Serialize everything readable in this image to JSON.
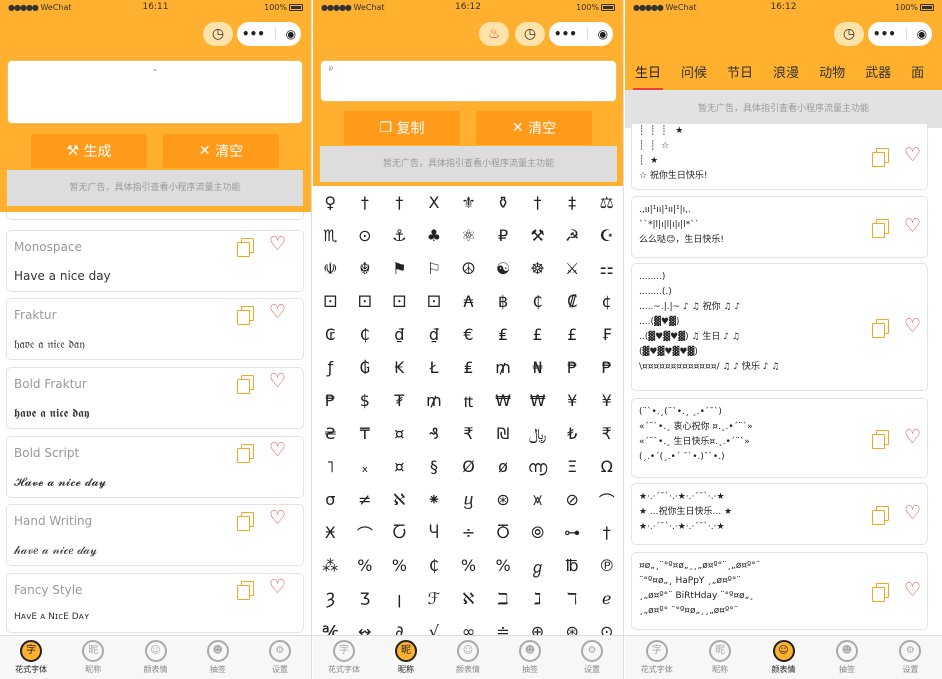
{
  "status": {
    "carrier": "WeChat",
    "battery": "100%",
    "time1": "16:11",
    "time2": "16:12",
    "time3": "16:12"
  },
  "capsule": {
    "menu": "•••",
    "close": "◉"
  },
  "panel1": {
    "input_value": "-",
    "generate_label": "生成",
    "clear_label": "清空",
    "ad_text": "暂无广告，具体指引查看小程序流量主功能",
    "styles": [
      {
        "name": "Monospace",
        "sample": "Have a nice day"
      },
      {
        "name": "Fraktur",
        "sample": "𝔥𝔞𝔳𝔢 𝔞 𝔫𝔦𝔠𝔢 𝔡𝔞𝔶"
      },
      {
        "name": "Bold Fraktur",
        "sample": "𝖍𝖆𝖛𝖊 𝖆 𝖓𝖎𝖈𝖊 𝖉𝖆𝖞"
      },
      {
        "name": "Bold Script",
        "sample": "𝓗𝓪𝓿𝓮 𝓪 𝓷𝓲𝓬𝓮 𝓭𝓪𝔂"
      },
      {
        "name": "Hand Writing",
        "sample": "𝒽𝒶𝓋𝑒 𝒶 𝓃𝒾𝒸𝑒 𝒹𝒶𝓎"
      },
      {
        "name": "Fancy Style",
        "sample": "HᴀᴠE ᴀ NɪᴄE Dᴀʏ"
      }
    ]
  },
  "panel2": {
    "input_value": "ᵖ",
    "copy_label": "复制",
    "clear_label": "清空",
    "ad_text": "暂无广告，具体指引查看小程序流量主功能",
    "symbols": [
      "♀",
      "†",
      "†",
      "Ⅹ",
      "⚜",
      "⚱",
      "†",
      "‡",
      "⚖",
      "♏",
      "⊙",
      "⚓",
      "♣",
      "⚛",
      "₽",
      "⚒",
      "☭",
      "☪",
      "☫",
      "☬",
      "⚑",
      "⚐",
      "☮",
      "☯",
      "☸",
      "⚔",
      "⚏",
      "⚀",
      "⚀",
      "⚀",
      "⚀",
      "₳",
      "฿",
      "₵",
      "₡",
      "¢",
      "₢",
      "₵",
      "₫",
      "₫",
      "€",
      "₤",
      "£",
      "£",
      "₣",
      "ƒ",
      "₲",
      "₭",
      "Ł",
      "₤",
      "₥",
      "₦",
      "₱",
      "₱",
      "₱",
      "$",
      "₮",
      "₥",
      "₶",
      "₩",
      "₩",
      "¥",
      "¥",
      "₴",
      "₸",
      "¤",
      "₰",
      "₹",
      "₪",
      "﷼",
      "₺",
      "₹",
      "˥",
      "ₓ",
      "¤",
      "§",
      "Ø",
      "ø",
      "൬",
      "Ξ",
      "Ω",
      "σ",
      "≠",
      "ℵ",
      "⁕",
      "ⴁ",
      "⊛",
      "⩙",
      "⊘",
      "⌒",
      "Ӿ",
      "⌒",
      "Ⴀ",
      "Ⴗ",
      "÷",
      "Ⴃ",
      "⦾",
      "⊶",
      "†",
      "⁂",
      "%",
      "%",
      "₵",
      "%",
      "%",
      "ℊ",
      "℔",
      "℗",
      "Ȝ",
      "Ʒ",
      "ꞁ",
      "ℱ",
      "ℵ",
      "ℶ",
      "ℷ",
      "ℸ",
      "ℯ",
      "℀",
      "↭",
      "∂",
      "√",
      "∞",
      "≐",
      "⊕",
      "⊛",
      "⊙"
    ]
  },
  "panel3": {
    "categories": [
      "生日",
      "问候",
      "节日",
      "浪漫",
      "动物",
      "武器",
      "面"
    ],
    "ad_text": "暂无广告，具体指引查看小程序流量主功能",
    "greetings": [
      "┊  ┊  ┊   ★\n┊  ┊  ☆\n┊  ★\n☆ 祝你生日快乐!",
      ".,ıı|¹ıı|¹ıı|¹|ı,.\n``*|l|ı|l|ı|ı|l*``\n么么哒😊，生日快乐!",
      "........)\n........(.)\n.....~.|.|~ ♪ ♫ 祝你 ♫ ♪\n....(▓♥▓)\n..(▓♥▓♥▓) ♫ 生日 ♪ ♫\n(▓♥▓♥▓♥▓)\n\\¤¤¤¤¤¤¤¤¤¤¤¤¤/ ♫ ♪ 快乐 ♪ ♫",
      "(¨`•.¸(¨`•.¸ ¸.•´¯`)\n«´¨`•.¸ 衷心祝你 ¤.¸.•´¨`»\n«´¨`•.¸ 生日快乐¤.¸.•´¨`»\n(¸.•´(¸.•´ ¯`•.)¯`•.)",
      "★·.·´¯`·.·★·.·´¯`·.·★\n★ ...祝你生日快乐... ★\n★·.·´¯`·.·★·.·´¯`·.·★",
      "¤ø„¸¨°º¤ø„¸¸„ø¤º°¨¸„ø¤º°¨\n¨°º¤ø„¸ HaPpY ¸„ø¤º°¨\n¸„ø¤º°¨ BiRtHday ¨°º¤ø„¸\n¸„ø¤º° ¨°º¤ø„¸¸„ø¤º°¨"
    ]
  },
  "tabs": [
    {
      "label": "花式字体",
      "icon": "trash-cup-icon",
      "glyph": "字"
    },
    {
      "label": "昵称",
      "icon": "nickname-icon",
      "glyph": "昵"
    },
    {
      "label": "颜表情",
      "icon": "smiley-icon",
      "glyph": "☺"
    },
    {
      "label": "抽签",
      "icon": "emoji-wink-icon",
      "glyph": "☻"
    },
    {
      "label": "设置",
      "icon": "gear-icon",
      "glyph": "⚙"
    }
  ],
  "colors": {
    "accent": "#FFB02E",
    "button": "#FF9A1A",
    "heart": "#E8413A"
  }
}
